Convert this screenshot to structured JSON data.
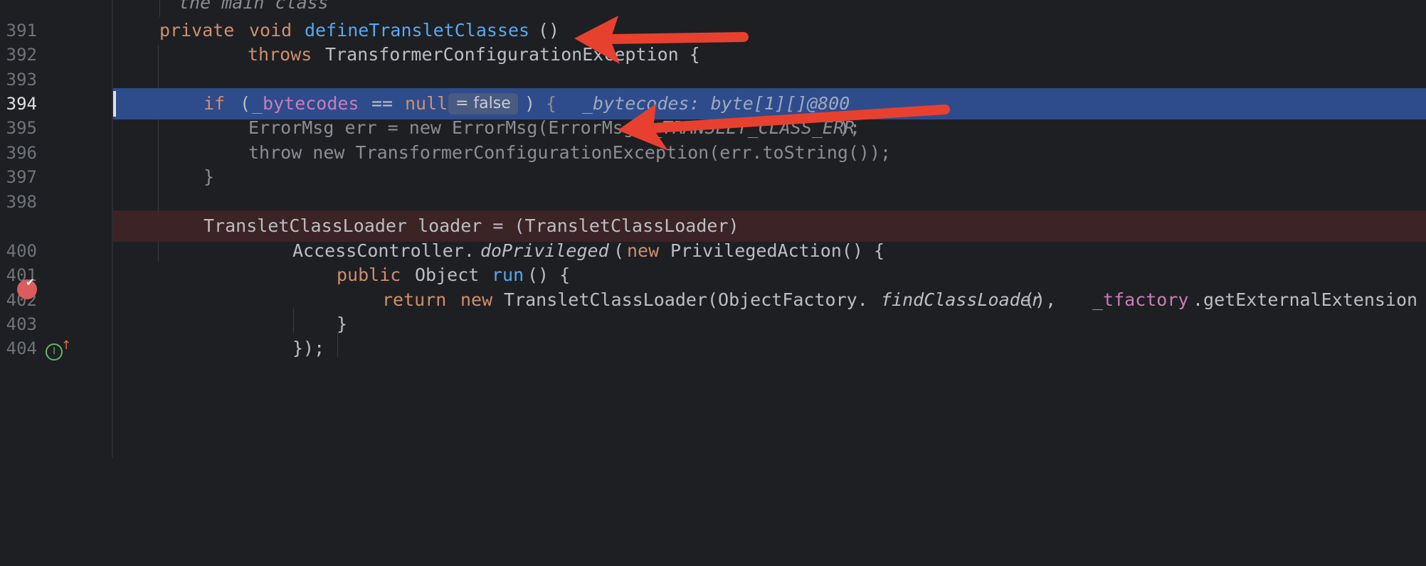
{
  "gutter": {
    "line_numbers": [
      "391",
      "392",
      "393",
      "394",
      "395",
      "396",
      "397",
      "398",
      "400",
      "401",
      "402",
      "403",
      "404"
    ]
  },
  "code": {
    "top_fragment": "the main class",
    "l391": {
      "mod": "private",
      "type": "void",
      "name": "defineTransletClasses",
      "tail": "()"
    },
    "l392": {
      "kw": "throws",
      "rest": "TransformerConfigurationException {"
    },
    "l394": {
      "if": "if",
      "open": "(",
      "field": "_bytecodes",
      "op": "==",
      "null": "null",
      "inlay": "= false",
      "close": ")",
      "brace": "{",
      "inline_value": "_bytecodes: byte[1][]@800"
    },
    "l395": {
      "pre": "ErrorMsg err = new ErrorMsg(ErrorMsg.",
      "const": "NO_TRANSLET_CLASS_ERR",
      "post": ");"
    },
    "l396": "throw new TransformerConfigurationException(err.toString());",
    "l397": "}",
    "l399": "TransletClassLoader loader = (TransletClassLoader)",
    "l400": {
      "pre": "AccessController.",
      "method": "doPrivileged",
      "open": "(",
      "kw": "new",
      "rest": "PrivilegedAction() {"
    },
    "l401": {
      "mod": "public",
      "rest": "Object",
      "method": "run",
      "tail": "() {"
    },
    "l402": {
      "ret": "return",
      "kw": "new",
      "pre": "TransletClassLoader(ObjectFactory.",
      "method": "findClassLoader",
      "mid": "(), ",
      "field": "_tfactory",
      "post": ".getExternalExtension"
    },
    "l403": "}",
    "l404": "});"
  },
  "gutter_icons": {
    "breakpoint": "breakpoint-icon",
    "implements": "implements-method-icon",
    "implements_label": "I",
    "up_arrow": "↑"
  },
  "annotations": {
    "arrow_color": "#e8402f"
  },
  "colors": {
    "background": "#1e1f22",
    "execution_line": "#2e4c8c",
    "breakpoint_line": "#3b2326",
    "keyword": "#cf8e6d",
    "function": "#56a8f5",
    "field": "#c77dbb"
  }
}
